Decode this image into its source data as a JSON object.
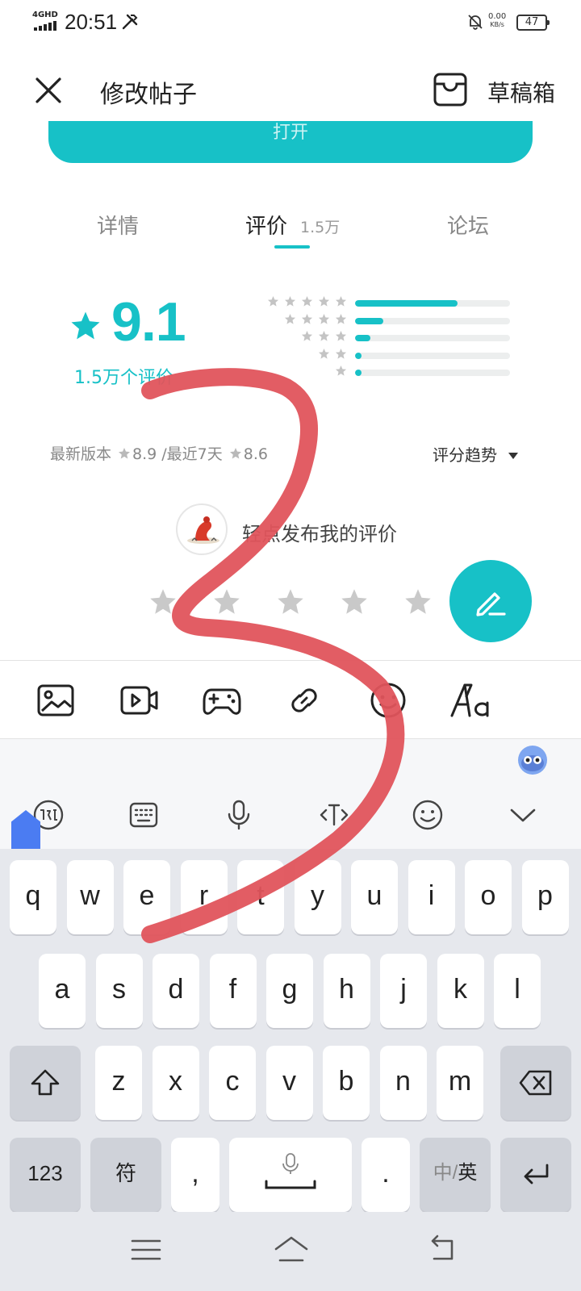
{
  "status_bar": {
    "network": "4GHD",
    "time": "20:51",
    "speed_value": "0.00",
    "speed_unit": "KB/s",
    "battery": "47"
  },
  "header": {
    "title": "修改帖子",
    "drafts_label": "草稿箱"
  },
  "app_card": {
    "open_button": "打开"
  },
  "tabs": {
    "detail": "详情",
    "reviews": "评价",
    "reviews_count": "1.5万",
    "forum": "论坛"
  },
  "rating": {
    "score": "9.1",
    "count_label": "1.5万个评价",
    "distribution": [
      {
        "stars": 5,
        "fraction": 0.66
      },
      {
        "stars": 4,
        "fraction": 0.18
      },
      {
        "stars": 3,
        "fraction": 0.1
      },
      {
        "stars": 2,
        "fraction": 0.04
      },
      {
        "stars": 1,
        "fraction": 0.04
      }
    ],
    "latest_version_label": "最新版本",
    "latest_version_score": "8.9",
    "recent_label": "/最近7天",
    "recent_score": "8.6",
    "trend_label": "评分趋势"
  },
  "review_prompt": {
    "text": "轻点发布我的评价",
    "star_count": 5
  },
  "editor_toolbar": {
    "tools": [
      "image-icon",
      "video-icon",
      "game-icon",
      "link-icon",
      "emoji-icon",
      "text-style-icon"
    ]
  },
  "ime_toolbar": {
    "tools": [
      "ime-logo-icon",
      "keyboard-icon",
      "microphone-icon",
      "text-cursor-icon",
      "emoji-icon",
      "chevron-down-icon"
    ]
  },
  "keyboard": {
    "row1": [
      "q",
      "w",
      "e",
      "r",
      "t",
      "y",
      "u",
      "i",
      "o",
      "p"
    ],
    "row2": [
      "a",
      "s",
      "d",
      "f",
      "g",
      "h",
      "j",
      "k",
      "l"
    ],
    "row3": [
      "z",
      "x",
      "c",
      "v",
      "b",
      "n",
      "m"
    ],
    "key_123": "123",
    "key_symbols": "符",
    "key_comma": ",",
    "key_period": ".",
    "key_lang_cn": "中/",
    "key_lang_en": "英"
  },
  "colors": {
    "accent": "#17c1c7",
    "scribble": "#e0545c"
  }
}
